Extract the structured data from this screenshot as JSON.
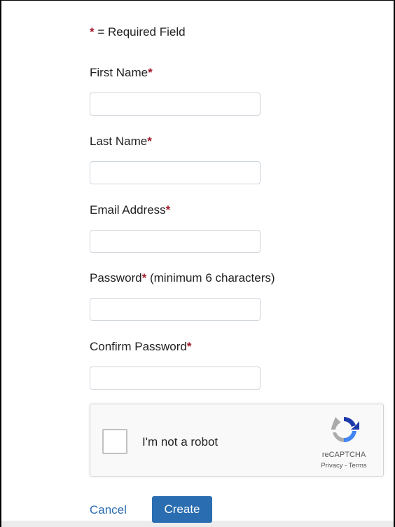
{
  "form": {
    "required_note": {
      "star": "*",
      "text": " = Required Field"
    },
    "fields": [
      {
        "label": "First Name",
        "star": "*",
        "value": "",
        "placeholder": ""
      },
      {
        "label": "Last Name",
        "star": "*",
        "value": "",
        "placeholder": ""
      },
      {
        "label": "Email Address",
        "star": "*",
        "value": "",
        "placeholder": ""
      },
      {
        "label": "Password",
        "star": "*",
        "hint": " (minimum 6 characters)",
        "value": "",
        "placeholder": ""
      },
      {
        "label": "Confirm Password",
        "star": "*",
        "value": "",
        "placeholder": ""
      }
    ],
    "recaptcha": {
      "label": "I'm not a robot",
      "brand": "reCAPTCHA",
      "privacy": "Privacy",
      "separator": " - ",
      "terms": "Terms",
      "logo_icon": "recaptcha-logo-icon"
    },
    "actions": {
      "cancel_label": "Cancel",
      "create_label": "Create"
    }
  },
  "colors": {
    "required_star": "#a0182b",
    "primary": "#2a6db0",
    "link": "#2a6db0"
  }
}
